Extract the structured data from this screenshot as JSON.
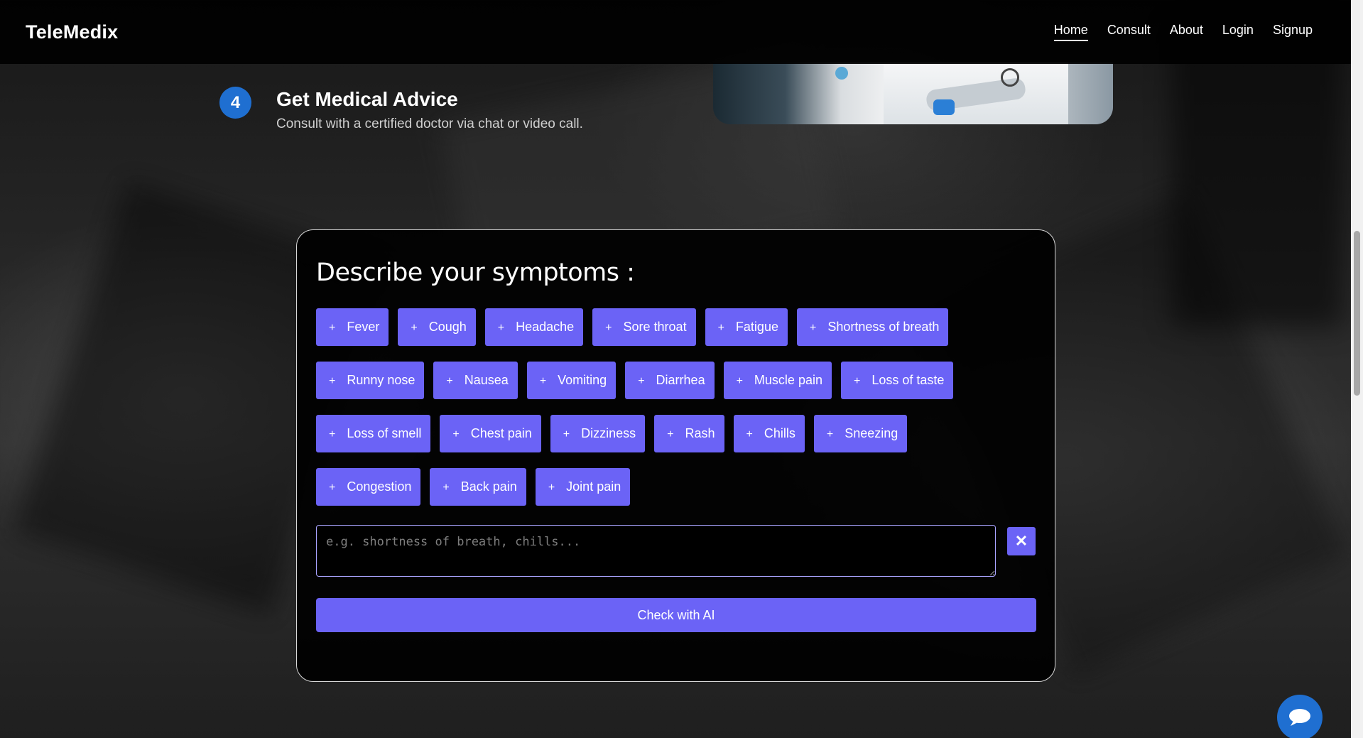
{
  "navbar": {
    "brand": "TeleMedix",
    "links": [
      "Home",
      "Consult",
      "About",
      "Login",
      "Signup"
    ]
  },
  "step": {
    "number": "4",
    "title": "Get Medical Advice",
    "description": "Consult with a certified doctor via chat or video call."
  },
  "symptoms": {
    "title": "Describe your symptoms :",
    "chip_prefix": "+",
    "rows": [
      [
        "Fever",
        "Cough",
        "Headache",
        "Sore throat",
        "Fatigue",
        "Shortness of breath"
      ],
      [
        "Runny nose",
        "Nausea",
        "Vomiting",
        "Diarrhea",
        "Muscle pain",
        "Loss of taste"
      ],
      [
        "Loss of smell",
        "Chest pain",
        "Dizziness",
        "Rash",
        "Chills",
        "Sneezing"
      ],
      [
        "Congestion",
        "Back pain",
        "Joint pain"
      ]
    ],
    "input_value": "",
    "input_placeholder": "e.g. shortness of breath, chills...",
    "clear_label": "✕",
    "check_label": "Check with AI"
  },
  "colors": {
    "accent": "#6b63f6",
    "step_badge": "#1f6fd1",
    "navbar_bg": "#000000"
  },
  "icons": {
    "chat": "chat-bubble-icon",
    "clear": "close-icon",
    "add": "plus-icon"
  }
}
